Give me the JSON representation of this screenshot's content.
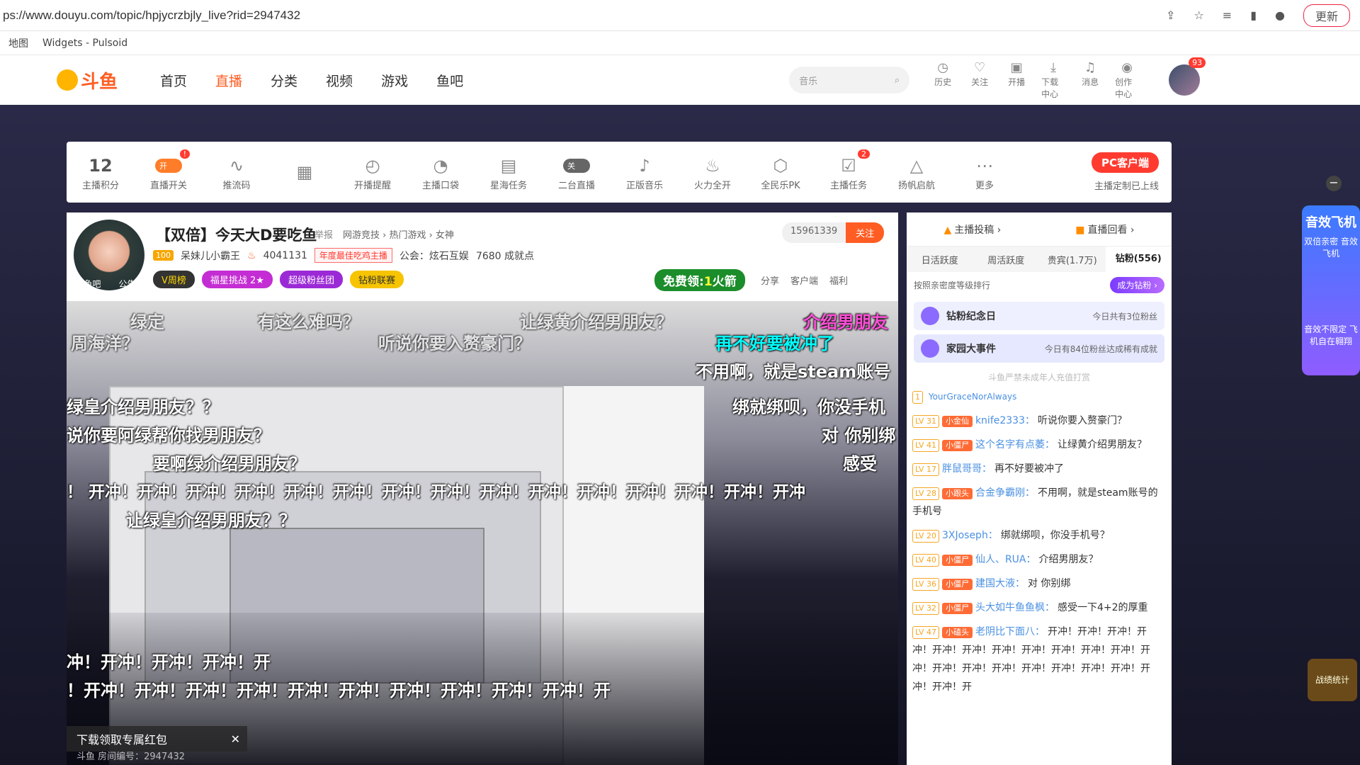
{
  "browser": {
    "url": "ps://www.douyu.com/topic/hpjycrzbjly_live?rid=2947432",
    "update_label": "更新",
    "bookmarks": [
      "地图",
      "Widgets - Pulsoid"
    ]
  },
  "header": {
    "logo_text": "斗鱼",
    "nav": [
      "首页",
      "直播",
      "分类",
      "视频",
      "游戏",
      "鱼吧"
    ],
    "search_placeholder": "音乐",
    "tools": [
      {
        "icon": "history-icon",
        "label": "历史"
      },
      {
        "icon": "heart-icon",
        "label": "关注"
      },
      {
        "icon": "camera-icon",
        "label": "开播"
      },
      {
        "icon": "download-icon",
        "label": "下载中心"
      },
      {
        "icon": "bell-icon",
        "label": "消息"
      },
      {
        "icon": "bulb-icon",
        "label": "创作中心"
      }
    ],
    "avatar_badge": "93"
  },
  "tools_bar": {
    "score": "12",
    "score_label": "主播积分",
    "items": [
      {
        "label": "直播开关",
        "toggle": "开",
        "badge": "!"
      },
      {
        "label": "推流码"
      },
      {
        "label": ""
      },
      {
        "label": "开播提醒"
      },
      {
        "label": "主播口袋"
      },
      {
        "label": "星海任务"
      },
      {
        "label": "二台直播",
        "toggle": "关"
      },
      {
        "label": "正版音乐"
      },
      {
        "label": "火力全开"
      },
      {
        "label": "全民乐PK"
      },
      {
        "label": "主播任务",
        "badge": "2"
      },
      {
        "label": "扬帆启航"
      },
      {
        "label": "更多"
      }
    ],
    "pc_client": "PC客户端",
    "pc_sub": "主播定制已上线"
  },
  "room": {
    "avatar_labels": [
      "鱼吧",
      "公告"
    ],
    "title": "【双倍】今天大D要吃鱼",
    "report": "举报",
    "category": "网游竞技 › 热门游戏 › 女神",
    "level": "100",
    "owner": "呆妹儿小霸王",
    "hot": "4041131",
    "award": "年度最佳吃鸡主播",
    "guild": "公会：炫石互娱",
    "achievement": "7680 成就点",
    "pills": [
      "V周榜",
      "福星挑战 2★",
      "超级粉丝团",
      "钻粉联赛"
    ],
    "follow_count": "15961339",
    "follow_label": "关注",
    "free_label_a": "免费领:",
    "free_label_num": "1",
    "free_label_b": "火箭",
    "actions": [
      "分享",
      "客户端",
      "福利"
    ]
  },
  "video": {
    "danmu": [
      "绿定",
      "有这么难吗？",
      "让绿黄介绍男朋友？",
      "介绍男朋友",
      "周海洋？",
      "听说你要入赘豪门？",
      "再不好要被冲了",
      "不用啊，就是steam账号",
      "绿皇介绍男朋友？？",
      "绑就绑呗，你没手机",
      "说你要阿绿帮你找男朋友？",
      "对 你别绑",
      "要啊绿介绍男朋友？",
      "感受",
      "！ 开冲！开冲！开冲！开冲！开冲！开冲！开冲！开冲！开冲！开冲！开冲！开冲！开冲！开冲！开冲",
      "让绿皇介绍男朋友？？",
      "冲！开冲！开冲！开冲！开",
      "！开冲！开冲！开冲！开冲！开冲！开冲！开冲！开冲！开冲！开冲！开"
    ],
    "download_banner": "下载领取专属红包",
    "room_no": "斗鱼 房间编号：2947432"
  },
  "chat": {
    "top_tabs": [
      "主播投稿 ›",
      "直播回看 ›"
    ],
    "rank_tabs": [
      "日活跃度",
      "周活跃度",
      "贵宾(1.7万)",
      "钻粉(556)"
    ],
    "rank_desc": "按照亲密度等级排行",
    "be_diamond": "成为钻粉 ›",
    "events": [
      {
        "title": "钻粉纪念日",
        "sub": "今日共有3位粉丝"
      },
      {
        "title": "家园大事件",
        "sub": "今日有84位粉丝达成稀有成就"
      }
    ],
    "notice": "斗鱼严禁未成年人充值打赏",
    "messages": [
      {
        "lv": "1",
        "fan": "",
        "nick": "YourGraceNorAlways",
        "text": ""
      },
      {
        "lv": "LV 31",
        "fan": "小金仙",
        "nick": "knife2333：",
        "text": "听说你要入赘豪门？"
      },
      {
        "lv": "LV 41",
        "fan": "小僵尸",
        "nick": "这个名字有点萎：",
        "text": "让绿黄介绍男朋友？"
      },
      {
        "lv": "LV 17",
        "fan": "",
        "nick": "胖鼠哥哥：",
        "text": "再不好要被冲了"
      },
      {
        "lv": "LV 28",
        "fan": "小跟头",
        "nick": "合金争霸刚：",
        "text": "不用啊，就是steam账号的手机号"
      },
      {
        "lv": "LV 20",
        "fan": "",
        "nick": "3XJoseph：",
        "text": "绑就绑呗，你没手机号？"
      },
      {
        "lv": "LV 40",
        "fan": "小僵尸",
        "nick": "仙人、RUA：",
        "text": "介绍男朋友？"
      },
      {
        "lv": "LV 36",
        "fan": "小僵尸",
        "nick": "建国大液：",
        "text": "对 你别绑"
      },
      {
        "lv": "LV 32",
        "fan": "小僵尸",
        "nick": "头大如牛鱼鱼枫：",
        "text": "感受一下4+2的厚重"
      },
      {
        "lv": "LV 47",
        "fan": "小磕头",
        "nick": "老阴比下面八：",
        "text": "开冲！开冲！开冲！开冲！开冲！开冲！开冲！开冲！开冲！开冲！开冲！开冲！开冲！开冲！开冲！开冲！开冲！开冲！开冲！开冲！开冲！开"
      }
    ]
  },
  "floats": {
    "minimize": "−",
    "widget_title": "音效飞机",
    "widget_sub": "双倍亲密 音效飞机",
    "widget_note": "音效不限定 飞机自在翱翔",
    "stats": "战绩统计"
  }
}
